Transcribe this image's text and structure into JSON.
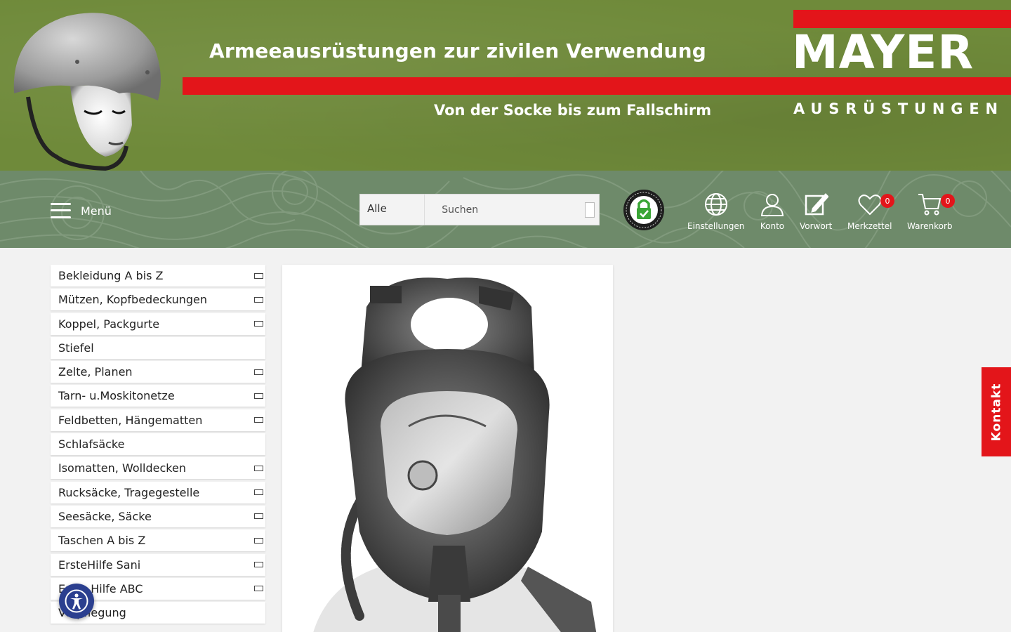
{
  "banner": {
    "tagline": "Armeeausrüstungen zur zivilen Verwendung",
    "slogan": "Von der Socke bis zum Fallschirm",
    "brand_name": "MAYER",
    "brand_sub": "AUSRÜSTUNGEN",
    "colors": {
      "green": "#6f8a3a",
      "red": "#e3151a"
    }
  },
  "navbar": {
    "menu_label": "Menü",
    "search": {
      "category": "Alle",
      "placeholder": "Suchen"
    },
    "seal_icon": "datenschutz-seal-icon",
    "items": [
      {
        "label": "Einstellungen",
        "icon": "globe-icon"
      },
      {
        "label": "Konto",
        "icon": "user-icon"
      },
      {
        "label": "Vorwort",
        "icon": "edit-icon"
      },
      {
        "label": "Merkzettel",
        "icon": "heart-icon",
        "count": "0"
      },
      {
        "label": "Warenkorb",
        "icon": "cart-icon",
        "count": "0"
      }
    ]
  },
  "categories": [
    {
      "label": "Bekleidung A bis Z",
      "expandable": true
    },
    {
      "label": "Mützen, Kopfbedeckungen",
      "expandable": true
    },
    {
      "label": "Koppel, Packgurte",
      "expandable": true
    },
    {
      "label": "Stiefel",
      "expandable": false
    },
    {
      "label": "Zelte, Planen",
      "expandable": true
    },
    {
      "label": "Tarn- u.Moskitonetze",
      "expandable": true
    },
    {
      "label": "Feldbetten, Hängematten",
      "expandable": true
    },
    {
      "label": "Schlafsäcke",
      "expandable": false
    },
    {
      "label": "Isomatten, Wolldecken",
      "expandable": true
    },
    {
      "label": "Rucksäcke, Tragegestelle",
      "expandable": true
    },
    {
      "label": "Seesäcke, Säcke",
      "expandable": true
    },
    {
      "label": "Taschen A bis Z",
      "expandable": true
    },
    {
      "label": "ErsteHilfe Sani",
      "expandable": true
    },
    {
      "label": "Erste Hilfe ABC",
      "expandable": true
    },
    {
      "label": "Verpflegung",
      "expandable": false
    }
  ],
  "kontakt_label": "Kontakt",
  "accessibility_icon": "accessibility-icon"
}
